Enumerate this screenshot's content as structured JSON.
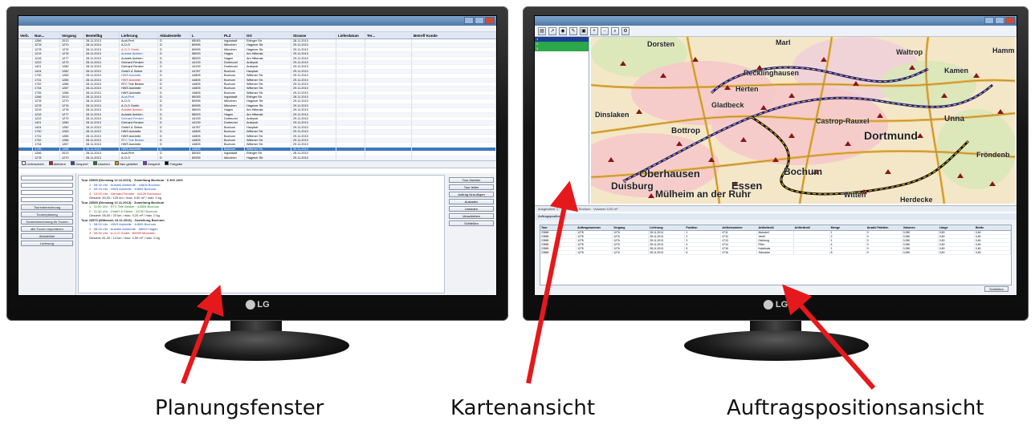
{
  "captions": {
    "planning": "Planungsfenster",
    "map": "Kartenansicht",
    "positions": "Auftragspositionsansicht"
  },
  "monitor_brand": "LG",
  "annotation_color": "#e5191c",
  "left_window": {
    "columns": [
      "Verb.",
      "Nan...",
      "Vorgang",
      "Bestellbg",
      "Lieferung",
      "Abladestelle",
      "L",
      "PLZ",
      "Ort",
      "Strasse",
      "Lieferdatum",
      "Ter...",
      "Betreff Kunde"
    ],
    "rows": [
      [
        "",
        "1266",
        "2013",
        "28.11.2013",
        "Audi-Pref",
        "D",
        "85045",
        "Ingolstadt",
        "Ettinger Str.",
        "28.11.2013",
        "",
        "",
        ""
      ],
      [
        "",
        "1278",
        "1270",
        "28.11.2013",
        "A-O-O",
        "D",
        "80995",
        "München",
        "Hagener Str.",
        "29.11.2013",
        "",
        "",
        ""
      ],
      [
        "",
        "1278",
        "1276",
        "28.11.2013",
        "A-O-O Gmbh",
        "D",
        "80995",
        "München",
        "Hagener Str.",
        "29.11.2013",
        "",
        "",
        ""
      ],
      [
        "",
        "1219",
        "1278",
        "28.11.2013",
        "Autotek Ambien.",
        "D",
        "58093",
        "Hagen",
        "Am Hiltenstr.",
        "29.11.2013",
        "",
        "",
        ""
      ],
      [
        "",
        "1216",
        "1277",
        "28.11.2013",
        "Autotek Ambien.",
        "D",
        "58093",
        "Hagen",
        "Am Hiltenstr.",
        "29.11.2013",
        "",
        "",
        ""
      ],
      [
        "",
        "1222",
        "1279",
        "28.11.2013",
        "Gerhard Fenster",
        "D",
        "44139",
        "Dortmund",
        "Ardeystr.",
        "29.11.2013",
        "",
        "",
        ""
      ],
      [
        "",
        "1421",
        "1280",
        "28.11.2013",
        "Gerhard Fenster",
        "D",
        "44139",
        "Dortmund",
        "Ardeystr.",
        "29.11.2013",
        "",
        "",
        ""
      ],
      [
        "",
        "1424",
        "1282",
        "28.11.2013",
        "GmbH & Sieber",
        "D",
        "44787",
        "Bochum",
        "Hauptstr.",
        "29.11.2013",
        "",
        "",
        ""
      ],
      [
        "",
        "1730",
        "1283",
        "28.11.2013",
        "HWS Autoteile",
        "D",
        "44805",
        "Bochum",
        "Wittener Str.",
        "29.11.2013",
        "",
        "",
        ""
      ],
      [
        "",
        "1731",
        "1285",
        "28.11.2013",
        "HWS Autoteile",
        "D",
        "44805",
        "Bochum",
        "Wittener Str.",
        "29.11.2013",
        "",
        "",
        ""
      ],
      [
        "",
        "1732",
        "1286",
        "28.11.2013",
        "RTC Tele Besker",
        "D",
        "44805",
        "Bochum",
        "Wittener Str.",
        "29.11.2013",
        "",
        "",
        ""
      ],
      [
        "",
        "1734",
        "1287",
        "28.11.2013",
        "HWS Autoteile",
        "D",
        "44805",
        "Bochum",
        "Wittener Str.",
        "29.11.2013",
        "",
        "",
        ""
      ],
      [
        "",
        "1735",
        "1288",
        "28.11.2013",
        "HWS Autoteile",
        "D",
        "44805",
        "Bochum",
        "Wittener Str.",
        "29.11.2013",
        "",
        "",
        ""
      ]
    ],
    "legend": [
      "Lieferschein",
      "Aktiviere",
      "Gesperrt",
      "Löschen",
      "Neu geliefert",
      "Gesperrt",
      "Freigabe"
    ],
    "tree_lines": [
      {
        "cls": "tour",
        "text": "Tour 23565 (Dienstag 12.11.2013) · Zustellung Bochum · 6 300 1301"
      },
      {
        "cls": "blue",
        "text": "1 · 08:30 Uhr · Autotek Ambiente · 44805 Bochum"
      },
      {
        "cls": "blue",
        "text": "2 · 09:15 Uhr · HWS Autoteile · 44805 Bochum"
      },
      {
        "cls": "red",
        "text": "3 · 10:00 Uhr · Gerhard Fenster · 44139 Dortmund"
      },
      {
        "cls": "",
        "text": "Gesamt: 45,00 / 125 km / max. 0,50 m³ / max. 0 kg"
      },
      {
        "cls": "tour",
        "text": "Tour 23569 (Dienstag 12.11.2013) · Zustellung Bochum"
      },
      {
        "cls": "green",
        "text": "1 · 11:00 Uhr · RTC Tele Besker · 44805 Bochum"
      },
      {
        "cls": "green",
        "text": "2 · 11:40 Uhr · GmbH & Sieber · 44787 Bochum"
      },
      {
        "cls": "",
        "text": "Gesamt: 06,00 / 23 km / max. 0,20 m³ / max. 0 kg"
      },
      {
        "cls": "tour",
        "text": "Tour 23570 (Mittwoch 13.11.2013) · Zustellung Bochum"
      },
      {
        "cls": "blue",
        "text": "1 · 08:00 Uhr · HWS Autoteile · 44805 Bochum"
      },
      {
        "cls": "blue",
        "text": "2 · 08:45 Uhr · Autotek Ambiente · 58093 Hagen"
      },
      {
        "cls": "red",
        "text": "3 · 09:30 Uhr · A-O-O Gmbh · 80995 München"
      },
      {
        "cls": "",
        "text": "Gesamt: 81,00 / 14 km / max. 0,50 m³ / max. 0 kg"
      }
    ],
    "left_buttons": [
      "Tourenberechnung",
      "Tourenplanung",
      "Tourenberechnung für Touren",
      "alle Touren importieren",
      "Abladeliste",
      "Lieferung"
    ],
    "right_buttons": [
      "Tour löschen",
      "Tour teilen",
      "Auftrag hinzufügen",
      "Ausladen",
      "Umladen",
      "Verschieben",
      "Schließen"
    ]
  },
  "right_window": {
    "side_rows": [
      "1",
      "2",
      "3"
    ],
    "status": "Ausgewählt: 1 · Tour: 23565 Bochum · Volumen 0,50 m³",
    "tab": "Auftragspositionen",
    "pos_columns": [
      "Tour",
      "Auftragsnummer",
      "Vorgang",
      "Lieferung",
      "Position",
      "Artikelnummer",
      "Artikeltext1",
      "Artikeltext2",
      "Menge",
      "Anzahl Paletten",
      "Volumen",
      "Länge",
      "Breite"
    ],
    "pos_rows": [
      [
        "23565",
        "1278",
        "1276",
        "28.11.2013",
        "1",
        "4711",
        "Motorteil",
        "",
        "1",
        "0",
        "0,050",
        "0,80",
        "0,60"
      ],
      [
        "23565",
        "1278",
        "1276",
        "28.11.2013",
        "2",
        "4712",
        "Ventil",
        "",
        "2",
        "0",
        "0,050",
        "0,80",
        "0,60"
      ],
      [
        "23565",
        "1278",
        "1276",
        "28.11.2013",
        "3",
        "4713",
        "Dichtung",
        "",
        "1",
        "0",
        "0,050",
        "0,80",
        "0,60"
      ],
      [
        "23565",
        "1278",
        "1276",
        "28.11.2013",
        "4",
        "4714",
        "Filter",
        "",
        "4",
        "0",
        "0,050",
        "0,80",
        "0,60"
      ],
      [
        "23565",
        "1278",
        "1276",
        "28.11.2013",
        "5",
        "4715",
        "Kabelsatz",
        "",
        "1",
        "0",
        "0,050",
        "0,80",
        "0,60"
      ],
      [
        "23565",
        "1278",
        "1276",
        "28.11.2013",
        "6",
        "4716",
        "Schraube",
        "",
        "8",
        "0",
        "0,050",
        "0,80",
        "0,60"
      ]
    ],
    "close_label": "Schließen",
    "map_labels": [
      {
        "text": "Dorsten",
        "size": 9
      },
      {
        "text": "Recklinghausen",
        "size": 9
      },
      {
        "text": "Waltrop",
        "size": 9
      },
      {
        "text": "Gladbeck",
        "size": 9
      },
      {
        "text": "Herten",
        "size": 9
      },
      {
        "text": "Kamen",
        "size": 9
      },
      {
        "text": "Bottrop",
        "size": 10
      },
      {
        "text": "Castrop-Rauxel",
        "size": 9
      },
      {
        "text": "Dortmund",
        "size": 14
      },
      {
        "text": "Unna",
        "size": 10
      },
      {
        "text": "Oberhausen",
        "size": 13
      },
      {
        "text": "Bochum",
        "size": 12
      },
      {
        "text": "Essen",
        "size": 13
      },
      {
        "text": "Mülheim an der Ruhr",
        "size": 12
      },
      {
        "text": "Duisburg",
        "size": 12
      },
      {
        "text": "Witten",
        "size": 9
      },
      {
        "text": "Herdecke",
        "size": 9
      },
      {
        "text": "Fröndenb",
        "size": 9
      },
      {
        "text": "Hamm",
        "size": 9
      },
      {
        "text": "Marl",
        "size": 9
      },
      {
        "text": "Dinslaken",
        "size": 9
      }
    ]
  }
}
